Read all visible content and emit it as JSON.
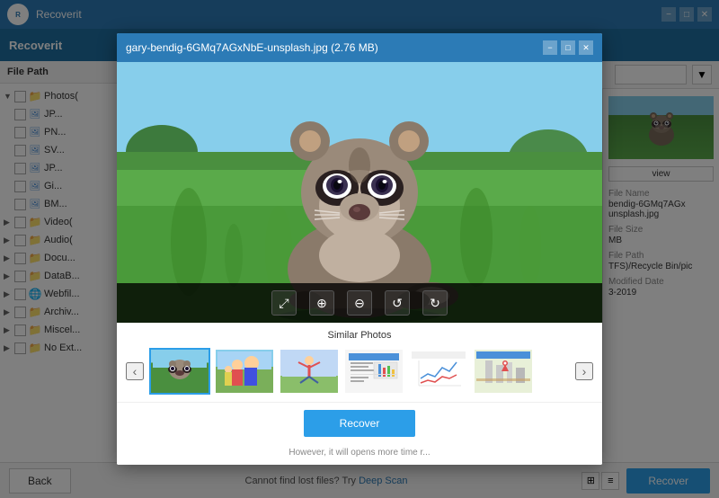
{
  "app": {
    "title": "Recoverit",
    "window_title": "gary-bendig-6GMq7AGxNbE-unsplash.jpg (2.76 MB)"
  },
  "title_bar": {
    "title": "Recoverit",
    "controls": {
      "minimize": "−",
      "maximize": "□",
      "close": "✕"
    }
  },
  "modal": {
    "title": "gary-bendig-6GMq7AGxNbE-unsplash.jpg (2.76 MB)",
    "controls": {
      "minimize": "−",
      "maximize": "□",
      "close": "✕"
    },
    "toolbar": {
      "zoom_fit": "⤢",
      "zoom_in": "⊕",
      "zoom_out": "⊖",
      "rotate_left": "↺",
      "rotate_right": "↻"
    },
    "similar_photos": {
      "title": "Similar Photos",
      "nav_left": "‹",
      "nav_right": "›"
    },
    "recover_btn": "Recover",
    "bottom_text": "However, it will opens more time r..."
  },
  "sidebar": {
    "header": "File Path",
    "items": [
      {
        "label": "Photos(",
        "type": "folder",
        "level": 0,
        "arrow": "▼",
        "checked": false
      },
      {
        "label": "JP...",
        "type": "file",
        "level": 1,
        "checked": false
      },
      {
        "label": "PN...",
        "type": "file",
        "level": 1,
        "checked": false
      },
      {
        "label": "SV...",
        "type": "file",
        "level": 1,
        "checked": false
      },
      {
        "label": "JP...",
        "type": "file",
        "level": 1,
        "checked": false
      },
      {
        "label": "Gi...",
        "type": "file",
        "level": 1,
        "checked": false
      },
      {
        "label": "BM...",
        "type": "file",
        "level": 1,
        "checked": false
      },
      {
        "label": "Video(",
        "type": "folder",
        "level": 0,
        "arrow": "▶",
        "checked": false
      },
      {
        "label": "Audio(",
        "type": "folder",
        "level": 0,
        "arrow": "▶",
        "checked": false
      },
      {
        "label": "Docu...",
        "type": "folder",
        "level": 0,
        "arrow": "▶",
        "checked": false
      },
      {
        "label": "DataB...",
        "type": "folder",
        "level": 0,
        "arrow": "▶",
        "checked": false
      },
      {
        "label": "Webfil...",
        "type": "folder",
        "level": 0,
        "arrow": "▶",
        "checked": false
      },
      {
        "label": "Archiv...",
        "type": "folder",
        "level": 0,
        "arrow": "▶",
        "checked": false
      },
      {
        "label": "Miscel...",
        "type": "folder",
        "level": 0,
        "arrow": "▶",
        "checked": false
      },
      {
        "label": "No Ext...",
        "type": "folder",
        "level": 0,
        "arrow": "▶",
        "checked": false
      }
    ]
  },
  "info_panel": {
    "view_btn": "view",
    "filename_label": "File Name",
    "filename_value": "bendig-6GMq7AGx\nunsplash.jpg",
    "size_label": "File Size",
    "size_value": "MB",
    "path_label": "File Path",
    "path_value": "TFS)/Recycle Bin/pic",
    "date_label": "Modified Date",
    "date_value": "3-2019"
  },
  "right_top": {
    "search_placeholder": "",
    "filter_icon": "▼"
  },
  "bottom_bar": {
    "back_btn": "Back",
    "cannot_find": "Cannot find lost files? Try ",
    "deep_scan": "Deep Scan",
    "recover_btn": "Recover",
    "view_grid": "⊞",
    "view_list": "≡"
  }
}
